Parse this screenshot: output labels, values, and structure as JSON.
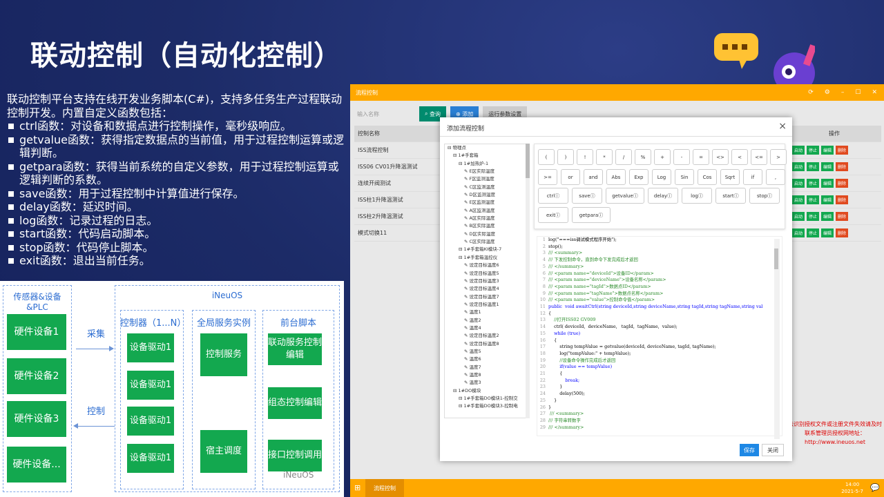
{
  "slide": {
    "title": "联动控制（自动化控制）",
    "intro": "联动控制平台支持在线开发业务脚本(C#)，支持多任务生产过程联动控制开发。内置自定义函数包括：",
    "functions": [
      "ctrl函数：对设备和数据点进行控制操作，毫秒级响应。",
      "getvalue函数：获得指定数据点的当前值，用于过程控制运算或逻辑判断。",
      "getpara函数：获得当前系统的自定义参数，用于过程控制运算或逻辑判断的系数。",
      "save函数：用于过程控制中计算值进行保存。",
      "delay函数：延迟时间。",
      "log函数：记录过程的日志。",
      "start函数：代码启动脚本。",
      "stop函数：代码停止脚本。",
      "exit函数：退出当前任务。"
    ]
  },
  "diagram": {
    "left_title": "传感器&设备&PLC",
    "right_title": "iNeuOS",
    "devices": [
      "硬件设备1",
      "硬件设备2",
      "硬件设备3",
      "硬件设备..."
    ],
    "collect_label": "采集",
    "control_label": "控制",
    "col1_title": "控制器（1...N）",
    "col2_title": "全局服务实例",
    "col3_title": "前台脚本",
    "drivers": [
      "设备驱动1",
      "设备驱动1",
      "设备驱动1",
      "设备驱动1"
    ],
    "services": [
      "控制服务",
      "宿主调度"
    ],
    "scripts": [
      "联动服务控制编辑",
      "组态控制编辑",
      "接口控制调用"
    ],
    "watermark": "iNeuOS"
  },
  "app": {
    "window_title": "流程控制",
    "input_placeholder": "输入名称",
    "query_button": "查询",
    "add_button": "添加",
    "params_button": "运行参数设置",
    "col_name": "控制名称",
    "col_action": "操作",
    "rows": [
      "ISS流程控制",
      "ISS06 CV01升降温测试",
      "连续开阀测试",
      "ISS柱1升降温测试",
      "ISS柱2升降温测试",
      "模式切换11"
    ],
    "action_labels": [
      "启动",
      "停止",
      "编辑",
      "删除"
    ],
    "red_msg": "法识别授权文件或注册文件失效请及时联系管理员授权网地址：http://www.ineuos.net",
    "taskbar_task": "流程控制",
    "clock_time": "14:00",
    "clock_date": "2021-5-7",
    "colors": {
      "orange": "#ffa800",
      "green": "#13a84f",
      "teal": "#008b6e",
      "red": "#e04a1f"
    }
  },
  "dialog": {
    "title": "添加流程控制",
    "tree": [
      "物理点",
      "1#手套箱",
      "1#加热炉-1",
      "E区实际温度",
      "F区监测温度",
      "C区监测温度",
      "D区监测温度",
      "E区监测温度",
      "A区监测温度",
      "A区实际温度",
      "B区实际温度",
      "D区实际温度",
      "C区实际温度",
      "1#手套箱KI模块-7",
      "1#手套箱温控仪",
      "设定目标温度6",
      "设定目标温度5",
      "设定目标温度3",
      "设定目标温度4",
      "设定目标温度7",
      "设定目标温度1",
      "温度1",
      "温度2",
      "温度4",
      "设定目标温度2",
      "设定目标温度8",
      "温度5",
      "温度6",
      "温度7",
      "温度8",
      "温度3",
      "1#DO模块",
      "1#手套箱DO模块1-控制交",
      "1#手套箱DO模块3-控制电"
    ],
    "ops_row1": [
      "(",
      ")",
      "!",
      "*",
      "/",
      "%",
      "+",
      "-",
      "=",
      "<>",
      "<",
      "<=",
      ">"
    ],
    "ops_row2": [
      ">=",
      "or",
      "and",
      "Abs",
      "Exp",
      "Log",
      "Sin",
      "Cos",
      "Sqrt",
      "if",
      ","
    ],
    "funcs_row3": [
      "ctrl",
      "save",
      "getvalue",
      "delay",
      "log",
      "start",
      "stop"
    ],
    "funcs_row4": [
      "exit",
      "getpara"
    ],
    "code_lines": [
      "log(\"===iss调试模式程序开始\");",
      "stop();",
      "/// <summary>",
      "/// 下发控制命令，直到命令下发完成后才返回",
      "/// </summary>",
      "/// <param name=\"deviceId\">设备ID</param>",
      "/// <param name=\"deviceName\">设备名称</param>",
      "/// <param name=\"tagId\">数据点ID</param>",
      "/// <param name=\"tagName\">数据点名称</param>",
      "/// <param name=\"value\">控制命令值</param>",
      "public  void awaitCtrl(string deviceId,string deviceName,string tagId,string tagName,string val",
      "{",
      "    //打开ISS02 GV009",
      "    ctrl( deviceId,  deviceName,   tagId,  tagName,  value);",
      "    while (true)",
      "    {",
      "        string tempValue = getvalue(deviceId, deviceName, tagId, tagName);",
      "        log(\"tempValue:\" + tempValue);",
      "        //设备命令操作完成后才返回",
      "        if(value == tempValue)",
      "        {",
      "            break;",
      "        }",
      "        delay(500);",
      "    }",
      "}",
      " /// <summary>",
      "/// 字符串转数字",
      "/// </summary>"
    ],
    "save_button": "保存",
    "close_button": "关闭"
  }
}
